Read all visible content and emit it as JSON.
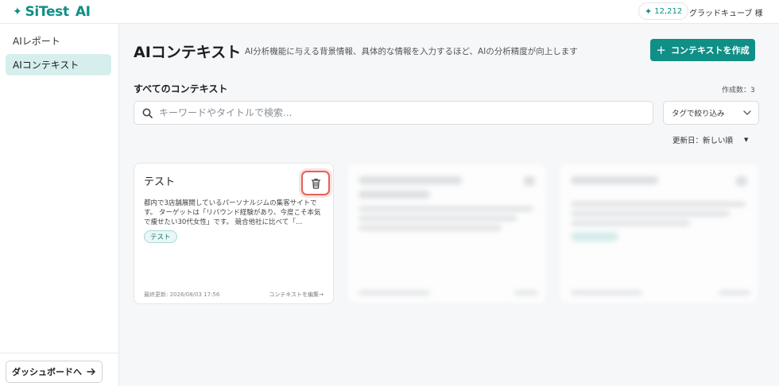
{
  "header": {
    "logo_text": "SiTest",
    "logo_ai": "AI",
    "credits": "12,212",
    "user_name": "グラッドキューブ 様"
  },
  "sidebar": {
    "items": [
      {
        "label": "AIレポート",
        "active": false
      },
      {
        "label": "AIコンテキスト",
        "active": true
      }
    ],
    "dashboard_button": "ダッシュボードへ"
  },
  "main": {
    "title": "AIコンテキスト",
    "description": "AI分析機能に与える背景情報、具体的な情報を入力するほど、AIの分析精度が向上します",
    "create_button": "コンテキストを作成",
    "section_title": "すべてのコンテキスト",
    "count_label": "作成数：3",
    "search": {
      "placeholder": "キーワードやタイトルで検索...",
      "value": ""
    },
    "tag_filter": "タグで絞り込み",
    "sort": "更新日：新しい順"
  },
  "cards": [
    {
      "title": "テスト",
      "description": "都内で3店舗展開しているパーソナルジムの集客サイトです。 ターゲットは「リバウンド経験があり、今度こそ本気で痩せたい30代女性」です。 競合他社に比べて「…",
      "tag": "テスト",
      "updated": "最終更新: 2026/08/03 17:56",
      "edit_link": "コンテキストを編集→"
    }
  ],
  "colors": {
    "accent": "#0f8f86",
    "active_bg": "#d6efed",
    "delete_highlight": "#e0625a"
  }
}
